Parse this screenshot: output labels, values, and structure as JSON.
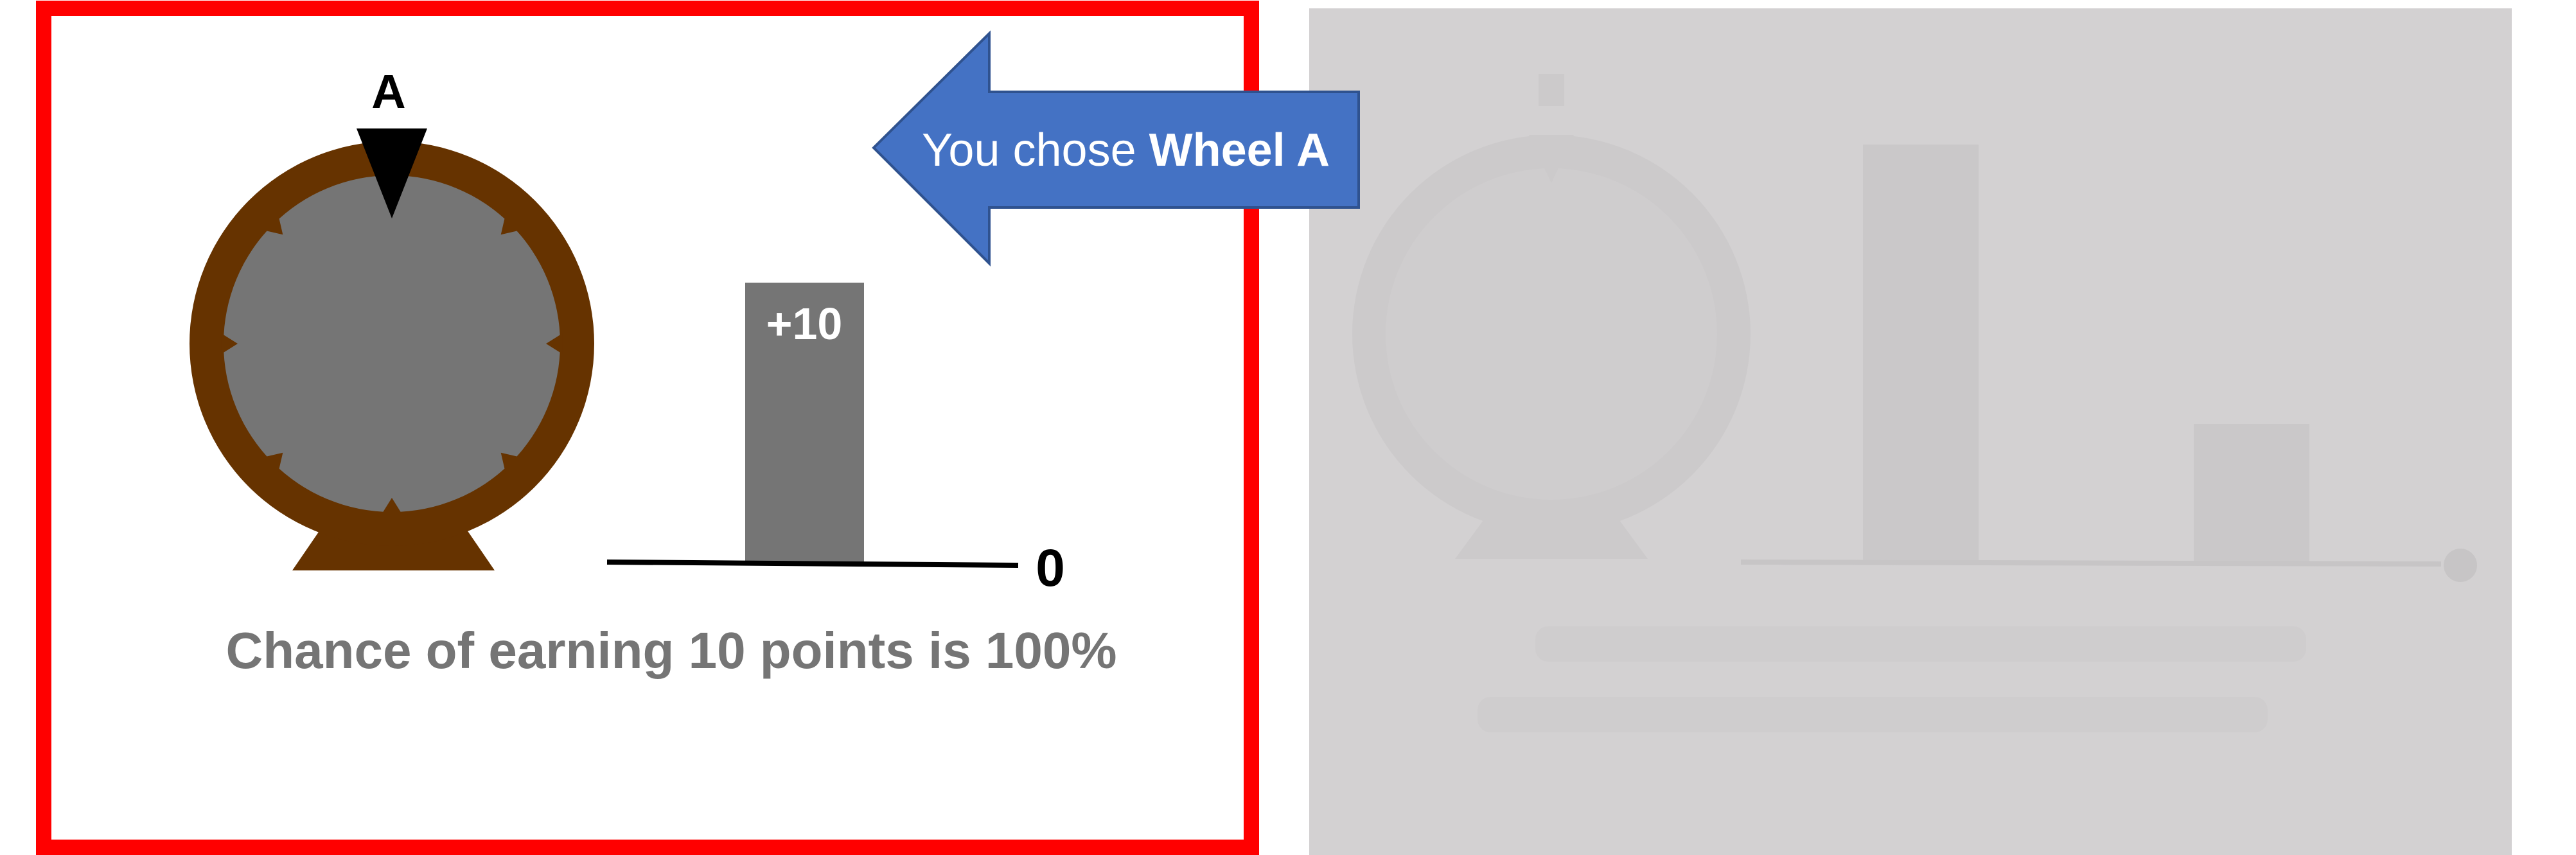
{
  "wheel_a": {
    "label": "A",
    "outcome_label": "+10",
    "baseline_label": "0",
    "caption": "Chance of earning 10 points is 100%",
    "selected": true
  },
  "choice_arrow": {
    "text_prefix": "You chose ",
    "text_choice": "Wheel A"
  },
  "wheel_b": {
    "state": "faded"
  },
  "colors": {
    "selection_border": "#ff0000",
    "wheel_rim": "#663300",
    "wheel_face": "#757575",
    "bar": "#757575",
    "arrow_fill": "#4472c4",
    "arrow_stroke": "#2f528f",
    "faded_panel": "#d3d1d2",
    "faded_shape": "#cbc9ca"
  }
}
